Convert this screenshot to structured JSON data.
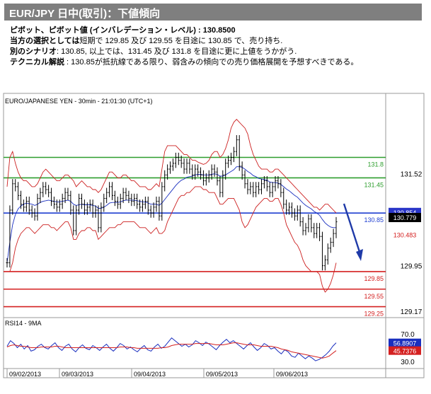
{
  "header": {
    "title": "EUR/JPY 日中(取引)：下値傾向"
  },
  "analysis": {
    "pivot_label": "ピボット、ピボット値 (インバレデーション・レベル) : ",
    "pivot_value": "130.8500",
    "choice_label": "当方の選択としては",
    "choice_text": "短期で 129.85 及び 129.55 を目途に 130.85 で、売り持ち.",
    "alt_label": "別のシナリオ",
    "alt_text": ": 130.85, 以上では、131.45 及び 131.8 を目途に更に上値をうかがう.",
    "tech_label": "テクニカル解説",
    "tech_text": " : 130.85が抵抗線である限り、弱含みの傾向での売り価格展開を予想すべきである。"
  },
  "chart_data": [
    {
      "type": "line",
      "subtype": "candlestick",
      "title": "EURO/JAPANESE YEN - 30min - 21:01:30 (UTC+1)",
      "ylim": [
        129.1,
        132.7
      ],
      "y_ticks": [
        "131.52",
        "129.95",
        "129.17"
      ],
      "x_ticks": [
        "09/02/2013",
        "09/03/2013",
        "09/04/2013",
        "09/05/2013",
        "09/06/2013"
      ],
      "grid": false,
      "levels": [
        {
          "label": "131.8",
          "value": 131.8,
          "color": "#2e9e2e"
        },
        {
          "label": "131.45",
          "value": 131.45,
          "color": "#2e9e2e"
        },
        {
          "label": "130.85",
          "value": 130.85,
          "color": "#1f3fd1"
        },
        {
          "label": "129.85",
          "value": 129.85,
          "color": "#d42020"
        },
        {
          "label": "129.55",
          "value": 129.55,
          "color": "#d42020"
        },
        {
          "label": "129.25",
          "value": 129.25,
          "color": "#d42020"
        }
      ],
      "price_tags": [
        {
          "label": "130.854",
          "value": 130.854,
          "color": "#2a36c8"
        },
        {
          "label": "130.779",
          "value": 130.779,
          "color": "#000000"
        },
        {
          "label": "130.483",
          "value": 130.483,
          "color": "#d42020"
        }
      ],
      "series": [
        {
          "kind": "price",
          "color": "#000000",
          "values": [
            130.0,
            130.9,
            131.35,
            131.3,
            131.15,
            131.0,
            130.95,
            131.05,
            130.9,
            130.85,
            130.8,
            131.1,
            131.2,
            131.3,
            131.25,
            131.2,
            131.05,
            131.0,
            130.95,
            131.0,
            131.1,
            131.2,
            131.15,
            130.9,
            130.55,
            130.9,
            131.1,
            131.0,
            130.9,
            130.95,
            131.0,
            130.85,
            130.9,
            130.6,
            130.95,
            131.1,
            131.2,
            131.3,
            131.15,
            131.05,
            131.0,
            131.1,
            131.2,
            131.15,
            131.1,
            131.05,
            131.1,
            131.0,
            130.95,
            131.0,
            131.05,
            130.9,
            130.85,
            130.95,
            131.05,
            130.8,
            131.3,
            131.5,
            131.6,
            131.65,
            131.7,
            131.8,
            131.75,
            131.7,
            131.6,
            131.7,
            131.6,
            131.5,
            131.6,
            131.55,
            131.5,
            131.4,
            131.45,
            131.5,
            131.6,
            131.55,
            131.4,
            131.2,
            131.5,
            131.7,
            131.75,
            131.8,
            131.9,
            132.1,
            131.65,
            131.5,
            131.35,
            131.25,
            131.3,
            131.2,
            131.3,
            131.25,
            131.35,
            131.4,
            131.3,
            131.2,
            131.3,
            131.4,
            131.35,
            131.2,
            131.0,
            130.9,
            130.95,
            130.85,
            130.8,
            130.9,
            130.7,
            130.55,
            130.6,
            130.75,
            130.6,
            130.5,
            130.6,
            130.45,
            129.95,
            130.05,
            130.25,
            130.35,
            130.5,
            130.7
          ]
        },
        {
          "kind": "moving_average",
          "color": "#1a2fbf",
          "values": [
            130.0,
            130.35,
            130.65,
            130.82,
            130.92,
            130.97,
            131.0,
            131.02,
            131.01,
            131.0,
            130.98,
            131.0,
            131.03,
            131.05,
            131.06,
            131.07,
            131.06,
            131.05,
            131.04,
            131.04,
            131.05,
            131.06,
            131.07,
            131.05,
            131.0,
            130.98,
            130.99,
            131.0,
            130.99,
            130.99,
            130.99,
            130.98,
            130.97,
            130.93,
            130.93,
            130.95,
            130.98,
            131.02,
            131.03,
            131.03,
            131.03,
            131.04,
            131.06,
            131.07,
            131.07,
            131.07,
            131.07,
            131.06,
            131.05,
            131.04,
            131.04,
            131.02,
            131.0,
            131.0,
            131.0,
            130.98,
            131.02,
            131.08,
            131.14,
            131.2,
            131.26,
            131.32,
            131.37,
            131.41,
            131.43,
            131.46,
            131.47,
            131.48,
            131.5,
            131.51,
            131.51,
            131.5,
            131.5,
            131.5,
            131.51,
            131.52,
            131.51,
            131.48,
            131.48,
            131.5,
            131.53,
            131.56,
            131.59,
            131.64,
            131.64,
            131.63,
            131.6,
            131.56,
            131.53,
            131.49,
            131.47,
            131.44,
            131.43,
            131.42,
            131.41,
            131.38,
            131.37,
            131.37,
            131.36,
            131.34,
            131.3,
            131.26,
            131.23,
            131.19,
            131.15,
            131.12,
            131.07,
            131.02,
            130.98,
            130.95,
            130.92,
            130.88,
            130.85,
            130.81,
            130.74,
            130.68,
            130.64,
            130.61,
            130.6,
            130.6
          ]
        },
        {
          "kind": "bollinger_upper",
          "color": "#cc1f1f",
          "values": [
            131.3,
            131.8,
            131.9,
            131.7,
            131.55,
            131.45,
            131.4,
            131.4,
            131.35,
            131.3,
            131.3,
            131.35,
            131.45,
            131.55,
            131.6,
            131.55,
            131.5,
            131.45,
            131.4,
            131.4,
            131.45,
            131.5,
            131.5,
            131.45,
            131.4,
            131.3,
            131.35,
            131.4,
            131.35,
            131.3,
            131.3,
            131.25,
            131.25,
            131.2,
            131.25,
            131.35,
            131.45,
            131.55,
            131.55,
            131.5,
            131.45,
            131.45,
            131.5,
            131.5,
            131.45,
            131.4,
            131.4,
            131.35,
            131.3,
            131.3,
            131.3,
            131.25,
            131.25,
            131.3,
            131.35,
            131.3,
            131.6,
            131.9,
            132.0,
            132.0,
            132.0,
            132.0,
            131.95,
            131.9,
            131.85,
            131.85,
            131.8,
            131.75,
            131.75,
            131.72,
            131.7,
            131.68,
            131.7,
            131.75,
            131.85,
            131.9,
            131.9,
            131.8,
            131.85,
            131.95,
            132.1,
            132.3,
            132.4,
            132.45,
            132.4,
            132.35,
            132.3,
            132.2,
            132.0,
            131.85,
            131.75,
            131.65,
            131.6,
            131.6,
            131.6,
            131.55,
            131.55,
            131.6,
            131.6,
            131.55,
            131.5,
            131.45,
            131.4,
            131.35,
            131.3,
            131.25,
            131.2,
            131.15,
            131.1,
            131.05,
            131.0,
            130.95,
            130.95,
            130.9,
            130.95,
            131.0,
            131.0,
            130.95,
            130.9,
            130.85
          ]
        },
        {
          "kind": "bollinger_lower",
          "color": "#cc1f1f",
          "values": [
            129.85,
            129.85,
            130.0,
            130.25,
            130.4,
            130.5,
            130.55,
            130.6,
            130.6,
            130.55,
            130.5,
            130.55,
            130.6,
            130.65,
            130.65,
            130.65,
            130.6,
            130.6,
            130.55,
            130.6,
            130.65,
            130.7,
            130.7,
            130.6,
            130.4,
            130.4,
            130.5,
            130.55,
            130.55,
            130.6,
            130.6,
            130.55,
            130.55,
            130.4,
            130.45,
            130.5,
            130.55,
            130.6,
            130.6,
            130.6,
            130.65,
            130.65,
            130.7,
            130.7,
            130.7,
            130.7,
            130.7,
            130.65,
            130.6,
            130.6,
            130.6,
            130.55,
            130.5,
            130.55,
            130.6,
            130.5,
            130.5,
            130.55,
            130.7,
            130.8,
            130.9,
            131.0,
            131.1,
            131.15,
            131.15,
            131.2,
            131.2,
            131.25,
            131.3,
            131.3,
            131.3,
            131.25,
            131.25,
            131.2,
            131.2,
            131.2,
            131.1,
            131.0,
            131.0,
            131.05,
            131.1,
            131.1,
            131.1,
            131.0,
            130.9,
            130.7,
            130.6,
            130.65,
            130.75,
            130.85,
            130.95,
            131.0,
            131.05,
            131.1,
            131.1,
            131.05,
            131.05,
            131.1,
            131.1,
            131.0,
            130.85,
            130.65,
            130.55,
            130.45,
            130.35,
            130.3,
            130.2,
            130.05,
            129.95,
            129.9,
            129.85,
            129.85,
            129.85,
            129.8,
            129.6,
            129.5,
            129.55,
            129.65,
            129.8,
            130.0
          ]
        }
      ]
    },
    {
      "type": "line",
      "title": "RSI14 - 9MA",
      "ylim": [
        22,
        82
      ],
      "y_ticks": [
        "70.0",
        "30.0"
      ],
      "grid": false,
      "tags": [
        {
          "label": "56.8907",
          "value": 56.8907,
          "color": "#1a2fbf"
        },
        {
          "label": "45.7376",
          "value": 45.7376,
          "color": "#d42020"
        }
      ],
      "series": [
        {
          "kind": "rsi",
          "color": "#1a2fbf",
          "values": [
            52,
            60,
            56,
            50,
            55,
            48,
            53,
            45,
            47,
            52,
            55,
            50,
            48,
            53,
            57,
            50,
            46,
            52,
            55,
            48,
            44,
            50,
            54,
            49,
            47,
            53,
            50,
            46,
            51,
            55,
            49,
            45,
            50,
            56,
            53,
            48,
            51,
            47,
            44,
            49,
            53,
            47,
            45,
            51,
            55,
            49,
            52,
            58,
            64,
            60,
            56,
            52,
            55,
            51,
            54,
            60,
            57,
            53,
            58,
            55,
            51,
            47,
            53,
            58,
            62,
            57,
            60,
            56,
            52,
            48,
            53,
            57,
            51,
            46,
            50,
            56,
            53,
            48,
            50,
            45,
            41,
            47,
            44,
            38,
            36,
            42,
            38,
            34,
            38,
            35,
            31,
            33,
            36,
            40,
            45,
            52,
            57
          ]
        },
        {
          "kind": "ma",
          "color": "#d42020",
          "values": [
            51,
            53,
            54,
            53,
            52,
            52,
            51,
            50,
            50,
            50,
            51,
            51,
            51,
            51,
            52,
            52,
            51,
            50,
            50,
            50,
            50,
            50,
            50,
            50,
            50,
            50,
            50,
            50,
            50,
            50,
            50,
            50,
            50,
            51,
            51,
            51,
            50,
            50,
            49,
            49,
            49,
            49,
            49,
            49,
            49,
            50,
            50,
            51,
            53,
            54,
            55,
            55,
            55,
            55,
            55,
            56,
            56,
            56,
            56,
            56,
            55,
            54,
            54,
            54,
            55,
            56,
            57,
            57,
            56,
            55,
            54,
            54,
            54,
            53,
            52,
            52,
            52,
            52,
            51,
            50,
            48,
            47,
            46,
            44,
            43,
            42,
            41,
            40,
            39,
            38,
            37,
            36,
            35,
            36,
            38,
            42,
            45.7
          ]
        }
      ]
    }
  ]
}
